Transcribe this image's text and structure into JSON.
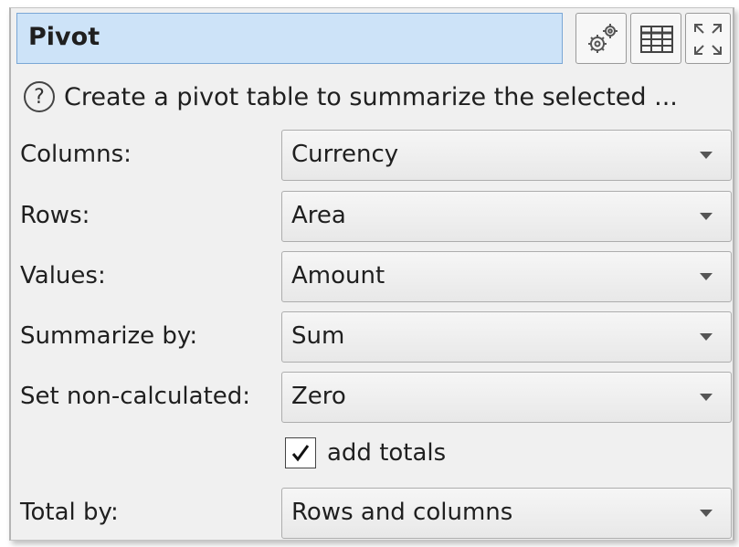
{
  "title": "Pivot",
  "toolbar": {
    "icons": [
      "settings-gears-icon",
      "table-view-icon",
      "maximize-icon"
    ]
  },
  "help": {
    "icon": "?",
    "text": "Create a pivot table to summarize the selected ..."
  },
  "fields": {
    "columns": {
      "label": "Columns:",
      "value": "Currency"
    },
    "rows": {
      "label": "Rows:",
      "value": "Area"
    },
    "values": {
      "label": "Values:",
      "value": "Amount"
    },
    "summarize_by": {
      "label": "Summarize by:",
      "value": "Sum"
    },
    "set_non_calculated": {
      "label": "Set non-calculated:",
      "value": "Zero"
    },
    "total_by": {
      "label": "Total by:",
      "value": "Rows and columns"
    }
  },
  "add_totals": {
    "label": "add totals",
    "checked": true,
    "mark": "✓"
  },
  "colors": {
    "title_bg": "#cde3f8",
    "title_border": "#7aa7d6",
    "panel_bg": "#f0f0f0"
  }
}
